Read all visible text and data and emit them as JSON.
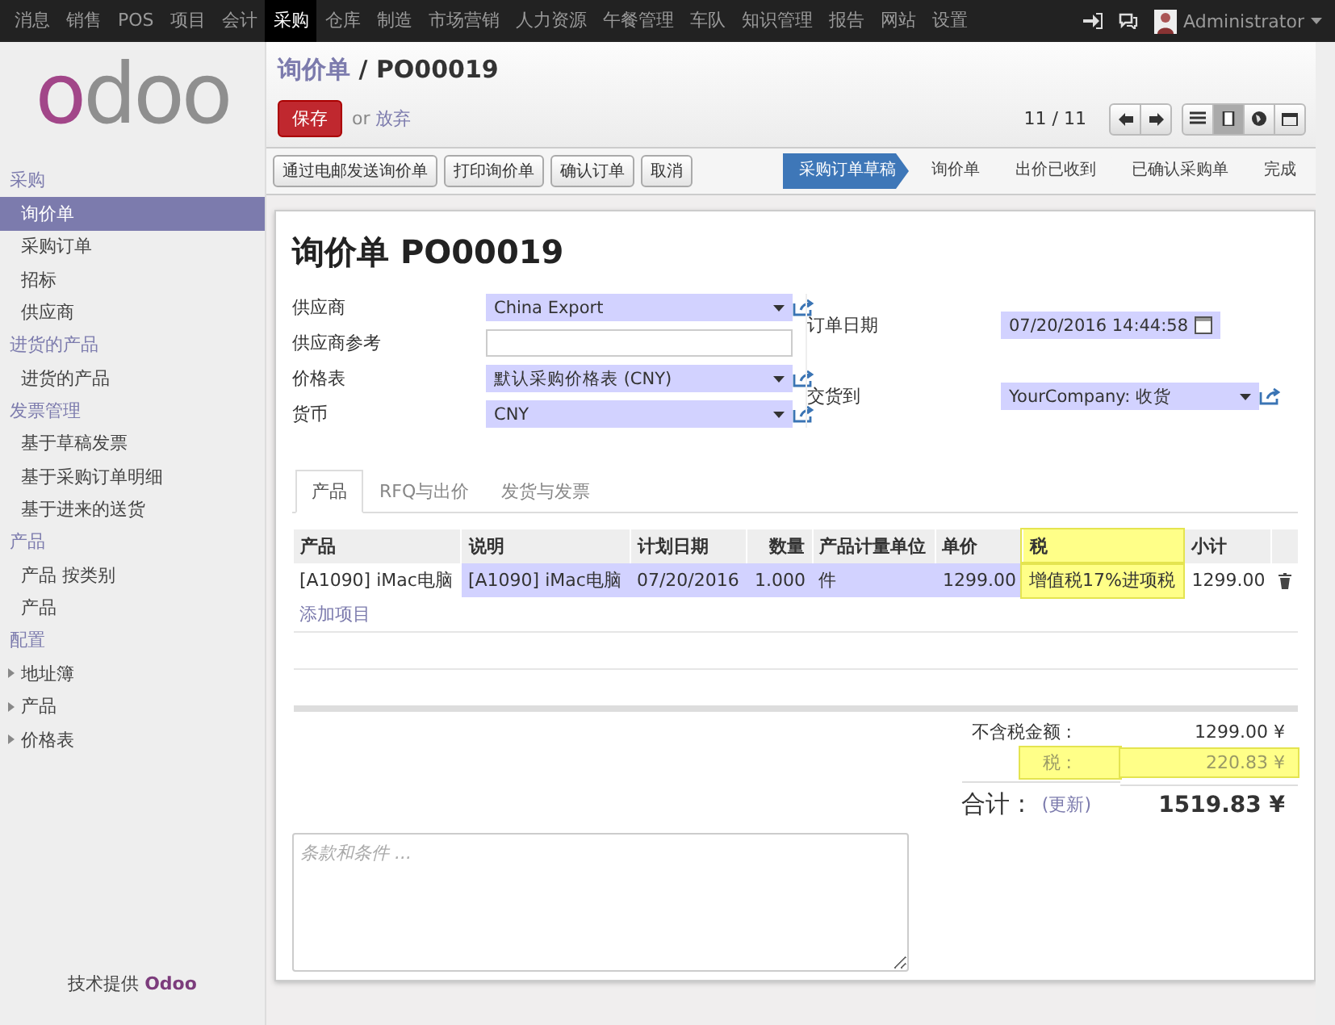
{
  "top_menu": [
    {
      "label": "消息",
      "selected": false
    },
    {
      "label": "销售",
      "selected": false
    },
    {
      "label": "POS",
      "selected": false
    },
    {
      "label": "项目",
      "selected": false
    },
    {
      "label": "会计",
      "selected": false
    },
    {
      "label": "采购",
      "selected": true
    },
    {
      "label": "仓库",
      "selected": false
    },
    {
      "label": "制造",
      "selected": false
    },
    {
      "label": "市场营销",
      "selected": false
    },
    {
      "label": "人力资源",
      "selected": false
    },
    {
      "label": "午餐管理",
      "selected": false
    },
    {
      "label": "车队",
      "selected": false
    },
    {
      "label": "知识管理",
      "selected": false
    },
    {
      "label": "报告",
      "selected": false
    },
    {
      "label": "网站",
      "selected": false
    },
    {
      "label": "设置",
      "selected": false
    }
  ],
  "user": {
    "name": "Administrator"
  },
  "logo": "odoo",
  "sidebar": {
    "sections": [
      {
        "title": "采购",
        "items": [
          {
            "label": "询价单",
            "selected": true,
            "expandable": false
          },
          {
            "label": "采购订单",
            "selected": false,
            "expandable": false
          },
          {
            "label": "招标",
            "selected": false,
            "expandable": false
          },
          {
            "label": "供应商",
            "selected": false,
            "expandable": false
          }
        ]
      },
      {
        "title": "进货的产品",
        "items": [
          {
            "label": "进货的产品",
            "selected": false,
            "expandable": false
          }
        ]
      },
      {
        "title": "发票管理",
        "items": [
          {
            "label": "基于草稿发票",
            "selected": false,
            "expandable": false
          },
          {
            "label": "基于采购订单明细",
            "selected": false,
            "expandable": false
          },
          {
            "label": "基于进来的送货",
            "selected": false,
            "expandable": false
          }
        ]
      },
      {
        "title": "产品",
        "items": [
          {
            "label": "产品 按类别",
            "selected": false,
            "expandable": false
          },
          {
            "label": "产品",
            "selected": false,
            "expandable": false
          }
        ]
      },
      {
        "title": "配置",
        "items": [
          {
            "label": "地址簿",
            "selected": false,
            "expandable": true
          },
          {
            "label": "产品",
            "selected": false,
            "expandable": true
          },
          {
            "label": "价格表",
            "selected": false,
            "expandable": true
          }
        ]
      }
    ]
  },
  "footer": {
    "text": "技术提供",
    "brand": "Odoo"
  },
  "breadcrumb": {
    "parent": "询价单",
    "separator": "/",
    "current": "PO00019"
  },
  "save_button": "保存",
  "or_text": "or",
  "discard_link": "放弃",
  "pager": "11 / 11",
  "views": [
    {
      "kind": "list",
      "selected": false
    },
    {
      "kind": "form",
      "selected": true
    },
    {
      "kind": "map",
      "selected": false
    },
    {
      "kind": "calendar",
      "selected": false
    }
  ],
  "actions": [
    "通过电邮发送询价单",
    "打印询价单",
    "确认订单",
    "取消"
  ],
  "stages": [
    {
      "label": "采购订单草稿",
      "selected": true
    },
    {
      "label": "询价单",
      "selected": false
    },
    {
      "label": "出价已收到",
      "selected": false
    },
    {
      "label": "已确认采购单",
      "selected": false
    },
    {
      "label": "完成",
      "selected": false
    }
  ],
  "form": {
    "title": "询价单 PO00019",
    "left_fields": [
      {
        "label": "供应商",
        "kind": "select",
        "value": "China Export"
      },
      {
        "label": "供应商参考",
        "kind": "text"
      },
      {
        "label": "价格表",
        "kind": "select",
        "value": "默认采购价格表 (CNY)"
      },
      {
        "label": "货币",
        "kind": "select",
        "value": "CNY"
      }
    ],
    "right_fields": [
      {
        "label": "订单日期",
        "kind": "date",
        "value": "07/20/2016 14:44:58"
      },
      {
        "label": "交货到",
        "kind": "select",
        "value": "YourCompany: 收货"
      }
    ],
    "tabs": [
      {
        "label": "产品",
        "selected": true
      },
      {
        "label": "RFQ与出价",
        "selected": false
      },
      {
        "label": "发货与发票",
        "selected": false
      }
    ],
    "table": {
      "columns": [
        {
          "label": "产品",
          "highlighted": false
        },
        {
          "label": "说明",
          "highlighted": false
        },
        {
          "label": "计划日期",
          "highlighted": false
        },
        {
          "label": "数量",
          "highlighted": false
        },
        {
          "label": "产品计量单位",
          "highlighted": false
        },
        {
          "label": "单价",
          "highlighted": false
        },
        {
          "label": "税",
          "highlighted": true
        },
        {
          "label": "小计",
          "highlighted": false
        }
      ],
      "rows": [
        {
          "cells": [
            "[A1090] iMac电脑",
            "[A1090] iMac电脑",
            "07/20/2016",
            "1.000",
            "件",
            "1299.00",
            "增值税17%进项税",
            "1299.00"
          ]
        }
      ],
      "add_item": "添加项目"
    },
    "totals": {
      "untaxed_label": "不含税金额 :",
      "untaxed": "1299.00 ¥",
      "tax_label": "税 :",
      "tax": "220.83 ¥",
      "tax_highlighted": true,
      "total_label": "合计 :",
      "update_link": "(更新)",
      "total": "1519.83 ¥"
    },
    "notes": {
      "placeholder": "条款和条件 ..."
    }
  }
}
